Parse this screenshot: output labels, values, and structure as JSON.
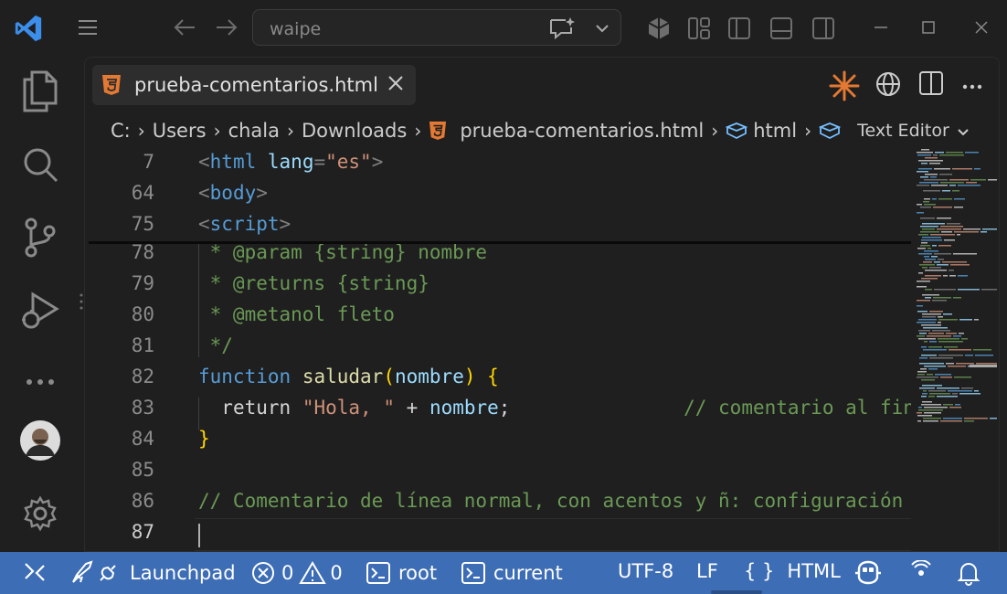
{
  "titlebar": {
    "search_text": "waipe"
  },
  "editor": {
    "tab_label": "prueba-comentarios.html",
    "breadcrumb": {
      "drive": "C:",
      "users": "Users",
      "user": "chala",
      "downloads": "Downloads",
      "file": "prueba-comentarios.html",
      "element": "html",
      "editor": "Text Editor"
    },
    "sticky": [
      {
        "ln": "7"
      },
      {
        "ln": "64"
      },
      {
        "ln": "75"
      }
    ],
    "lines": [
      {
        "ln": "78",
        "text": " * @param {string} nombre"
      },
      {
        "ln": "79",
        "text": " * @returns {string}"
      },
      {
        "ln": "80",
        "text": " * @metanol fleto"
      },
      {
        "ln": "81",
        "text": " */"
      },
      {
        "ln": "82"
      },
      {
        "ln": "83"
      },
      {
        "ln": "84",
        "text": "}"
      },
      {
        "ln": "85",
        "text": ""
      },
      {
        "ln": "86",
        "text": "// Comentario de línea normal, con acentos y ñ: configuración s"
      },
      {
        "ln": "87",
        "text": ""
      }
    ],
    "code": {
      "html_tag": "html",
      "lang_attr": "lang",
      "lang_val": "\"es\"",
      "body_tag": "body",
      "script_tag": "script",
      "kw_function": "function",
      "fn_name": "saludar",
      "param": "nombre",
      "kw_return": "return",
      "str_hola": "\"Hola, \"",
      "plus": "+",
      "var_nombre": "nombre",
      "semi": ";",
      "comment_end": "// comentario al fina"
    }
  },
  "statusbar": {
    "launchpad": "Launchpad",
    "errors": "0",
    "warnings": "0",
    "terminal1": "root",
    "terminal2": "current",
    "encoding": "UTF-8",
    "eol": "LF",
    "braces": "{ }",
    "language": "HTML"
  },
  "colors": {
    "statusbar_bg": "#3d6db5",
    "html_icon": "#e37933",
    "vscode_blue": "#3b8eea"
  }
}
